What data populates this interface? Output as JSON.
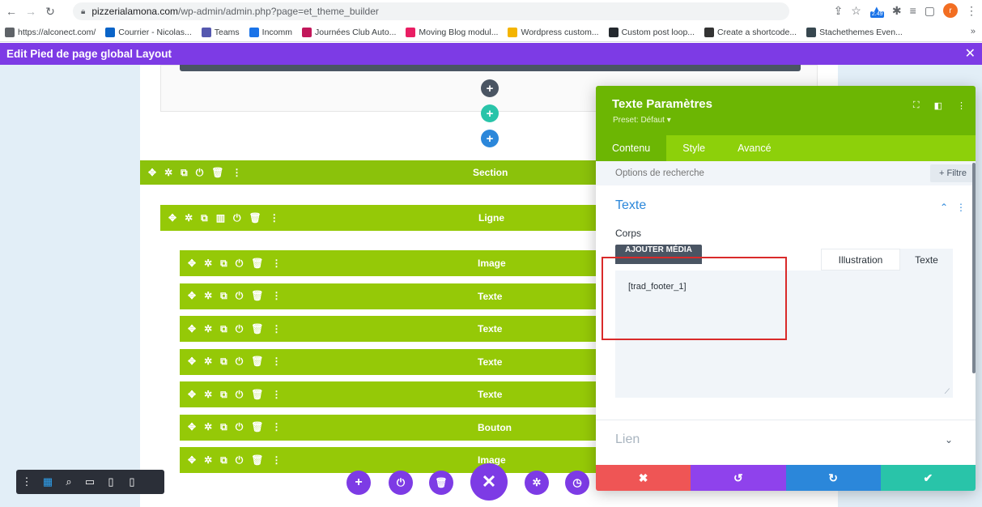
{
  "browser": {
    "url_host": "pizzerialamona.com",
    "url_path": "/wp-admin/admin.php?page=et_theme_builder",
    "extension_badge": "2.49",
    "avatar_letter": "r",
    "bookmarks": [
      {
        "label": "https://alconect.com/",
        "color": "#5f6368"
      },
      {
        "label": "Courrier - Nicolas...",
        "color": "#0a64c8"
      },
      {
        "label": "Teams",
        "color": "#5558af"
      },
      {
        "label": "Incomm",
        "color": "#1a73e8"
      },
      {
        "label": "Journées Club Auto...",
        "color": "#c2185b"
      },
      {
        "label": "Moving Blog modul...",
        "color": "#e91e63"
      },
      {
        "label": "Wordpress custom...",
        "color": "#f4b400"
      },
      {
        "label": "Custom post loop...",
        "color": "#24292e"
      },
      {
        "label": "Create a shortcode...",
        "color": "#333333"
      },
      {
        "label": "Stachethemes Even...",
        "color": "#37474f"
      }
    ],
    "bookmarks_more": "»"
  },
  "editor": {
    "title": "Edit Pied de page global Layout",
    "close": "✕"
  },
  "builder": {
    "section_label": "Section",
    "row_label": "Ligne",
    "modules": [
      "Image",
      "Texte",
      "Texte",
      "Texte",
      "Texte",
      "Bouton",
      "Image"
    ]
  },
  "panel": {
    "title": "Texte Paramètres",
    "preset": "Preset: Défaut ▾",
    "tabs": [
      "Contenu",
      "Style",
      "Avancé"
    ],
    "search_placeholder": "Options de recherche",
    "filter_label": "+ Filtre",
    "texte_section": "Texte",
    "corps_label": "Corps",
    "media_button": "AJOUTER MÉDIA",
    "mode_illustration": "Illustration",
    "mode_texte": "Texte",
    "editor_content": "[trad_footer_1]",
    "lien_section": "Lien"
  },
  "colors": {
    "header_purple": "#7d3be5",
    "module_green": "#95c907",
    "panel_green": "#6cb603",
    "cancel_red": "#ef5555",
    "undo_purple": "#8f42ec",
    "redo_blue": "#2b87da",
    "save_teal": "#29c4a9"
  }
}
